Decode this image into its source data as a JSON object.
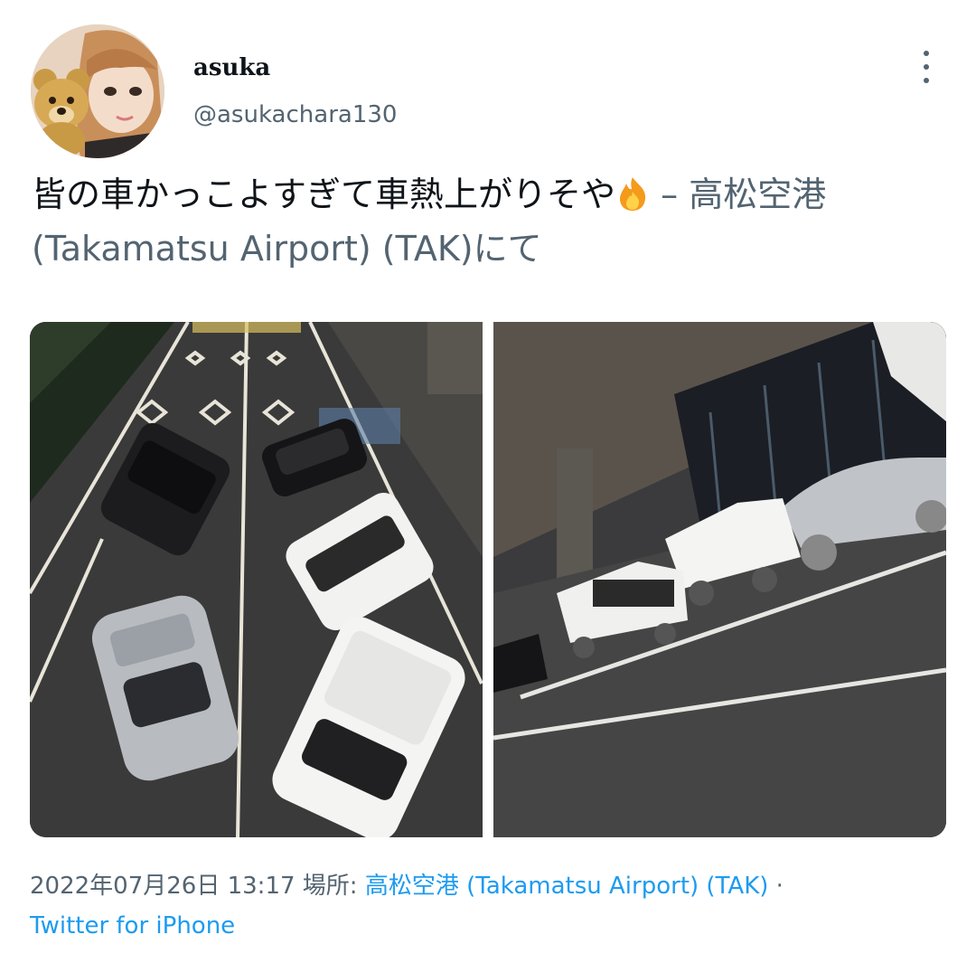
{
  "tweet": {
    "author_name": "asuka",
    "author_handle": "@asukachara130",
    "text_main": "皆の車かっこよすぎて車熱上がりそや",
    "emoji": "fire-emoji",
    "text_dash": " – ",
    "text_location": "高松空港 (Takamatsu Airport) (TAK)にて",
    "date_time": "2022年07月26日 13:17",
    "place_label": " 場所: ",
    "place_link": "高松空港 (Takamatsu Airport) (TAK)",
    "separator": " · ",
    "source": "Twitter for iPhone"
  },
  "colors": {
    "link": "#1d9bf0",
    "secondary": "#536471",
    "text": "#0f1419"
  },
  "icons": {
    "more": "more-vertical-icon"
  }
}
